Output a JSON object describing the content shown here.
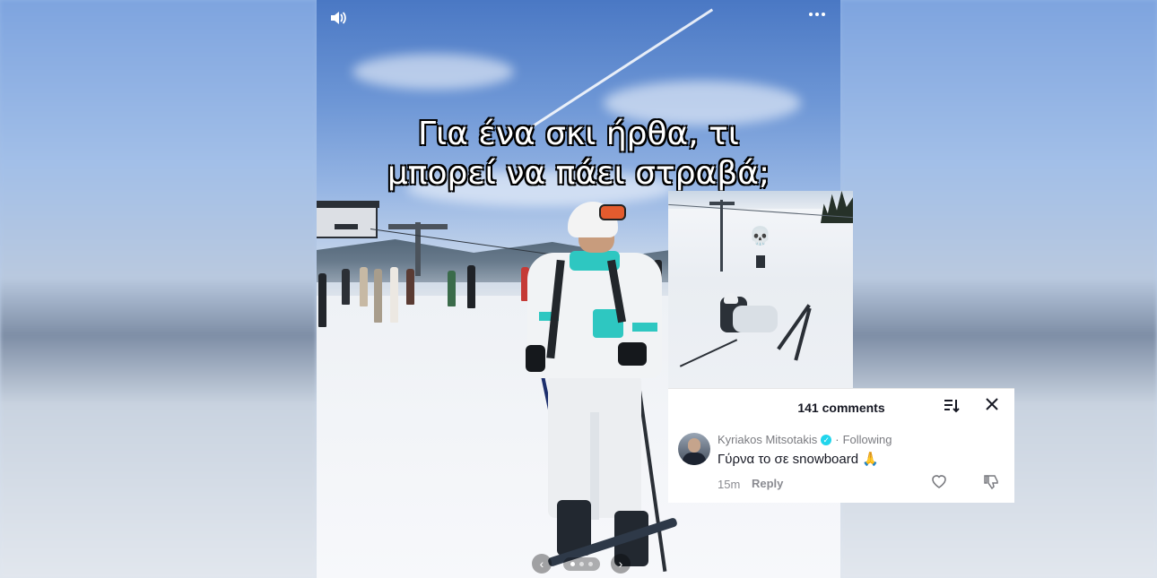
{
  "post": {
    "caption_line1": "Για ένα σκι ήρθα, τι",
    "caption_line2": "μπορεί να πάει στραβά;",
    "sound_icon": "speaker-icon",
    "more_icon": "more-options-icon",
    "carousel": {
      "prev": "‹",
      "next": "›",
      "dots": 3
    }
  },
  "inset": {
    "emoji": "💀"
  },
  "comments_panel": {
    "title": "141 comments",
    "sort_icon": "sort-icon",
    "close_label": "✕",
    "comment": {
      "username": "Kyriakos Mitsotakis",
      "verified": "✓",
      "separator": "·",
      "following": "Following",
      "text": "Γύρνα το σε snowboard 🙏",
      "time": "15m",
      "reply": "Reply"
    }
  }
}
